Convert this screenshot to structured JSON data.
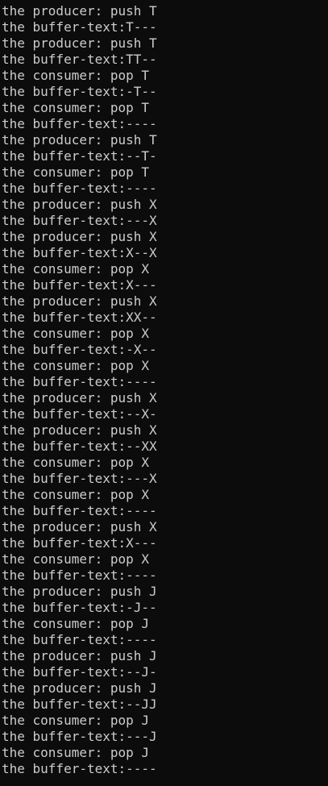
{
  "console": {
    "lines": [
      "the producer: push T",
      "the buffer-text:T---",
      "the producer: push T",
      "the buffer-text:TT--",
      "the consumer: pop T",
      "the buffer-text:-T--",
      "the consumer: pop T",
      "the buffer-text:----",
      "the producer: push T",
      "the buffer-text:--T-",
      "the consumer: pop T",
      "the buffer-text:----",
      "the producer: push X",
      "the buffer-text:---X",
      "the producer: push X",
      "the buffer-text:X--X",
      "the consumer: pop X",
      "the buffer-text:X---",
      "the producer: push X",
      "the buffer-text:XX--",
      "the consumer: pop X",
      "the buffer-text:-X--",
      "the consumer: pop X",
      "the buffer-text:----",
      "the producer: push X",
      "the buffer-text:--X-",
      "the producer: push X",
      "the buffer-text:--XX",
      "the consumer: pop X",
      "the buffer-text:---X",
      "the consumer: pop X",
      "the buffer-text:----",
      "the producer: push X",
      "the buffer-text:X---",
      "the consumer: pop X",
      "the buffer-text:----",
      "the producer: push J",
      "the buffer-text:-J--",
      "the consumer: pop J",
      "the buffer-text:----",
      "the producer: push J",
      "the buffer-text:--J-",
      "the producer: push J",
      "the buffer-text:--JJ",
      "the consumer: pop J",
      "the buffer-text:---J",
      "the consumer: pop J",
      "the buffer-text:----"
    ]
  },
  "colors": {
    "background": "#0c0c0c",
    "text": "#cccccc"
  }
}
